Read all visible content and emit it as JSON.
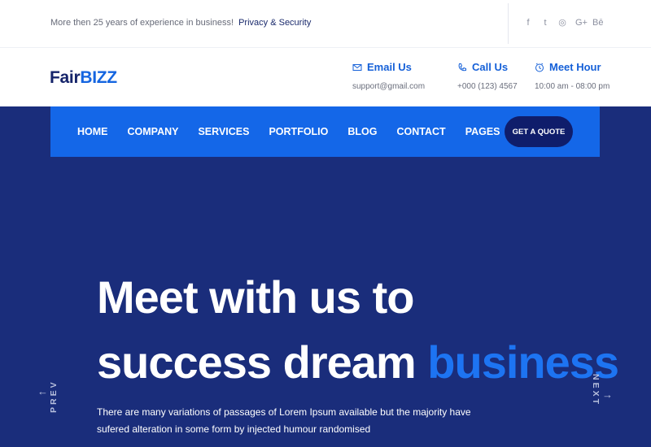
{
  "topbar": {
    "experience_text": "More then 25 years of experience in business!",
    "privacy_link": "Privacy & Security",
    "socials": [
      {
        "icon": "facebook-icon",
        "glyph": "f"
      },
      {
        "icon": "twitter-icon",
        "glyph": "t"
      },
      {
        "icon": "instagram-icon",
        "glyph": "◎"
      },
      {
        "icon": "google-plus-icon",
        "glyph": "G+"
      },
      {
        "icon": "behance-icon",
        "glyph": "Bē"
      }
    ]
  },
  "logo": {
    "part1": "Fair",
    "part2": "BIZZ"
  },
  "contacts": [
    {
      "icon": "envelope-icon",
      "title": "Email Us",
      "value": "support@gmail.com"
    },
    {
      "icon": "phone-icon",
      "title": "Call Us",
      "value": "+000 (123) 4567"
    },
    {
      "icon": "clock-icon",
      "title": "Meet Hour",
      "value": "10:00 am - 08:00 pm"
    }
  ],
  "nav": {
    "items": [
      "HOME",
      "COMPANY",
      "SERVICES",
      "PORTFOLIO",
      "BLOG",
      "CONTACT",
      "PAGES"
    ],
    "cta": "GET A QUOTE"
  },
  "hero": {
    "line1": "Meet with us to",
    "line2_prefix": "success dream",
    "line2_accent": "business",
    "subtext": "There are many variations of passages of Lorem Ipsum available but the majority have sufered alteration in some form by injected humour randomised",
    "prev_label": "PREV",
    "next_label": "NEXT"
  },
  "colors": {
    "brand_dark": "#15246a",
    "brand_blue": "#1467e8",
    "hero_bg": "#1a2d7b",
    "accent": "#1d74f2"
  }
}
